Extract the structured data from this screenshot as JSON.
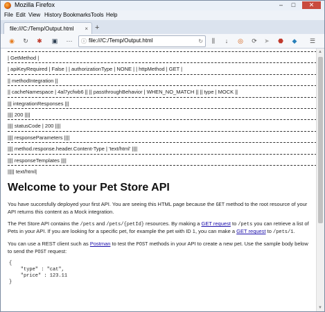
{
  "window": {
    "title": "Mozilla Firefox",
    "minimize": "–",
    "maximize": "□",
    "close": "✕"
  },
  "menu": [
    "File",
    "Edit",
    "View",
    "History",
    "Bookmarks",
    "Tools",
    "Help"
  ],
  "tab": {
    "title": "file:///C:/Temp/Output.html",
    "close": "×",
    "new_tab": "+"
  },
  "address": {
    "url": "file:///C:/Temp/Output.html"
  },
  "page": {
    "lines": [
      "| GetMethod |",
      "| apiKeyRequired | False | | authorizationType | NONE | | httpMethod | GET |",
      "|| methodIntegration ||",
      "|| cacheNamespace | 4al7ycfwb6 || || passthroughBehavior | WHEN_NO_MATCH || || type | MOCK ||",
      "||| integrationResponses |||",
      "|||| 200 ||||",
      "|||| statusCode | 200 ||||",
      "|||| responseParameters ||||",
      "|||| method.response.header.Content-Type | 'text/html' ||||",
      "|||| responseTemplates ||||",
      "||||| text/html|"
    ],
    "heading": "Welcome to your Pet Store API",
    "p1": {
      "a": "You have succesfully deployed your first API. You are seeing this HTML page because the ",
      "code": "GET",
      "b": " method to the root resource of your API returns this content as a Mock integration."
    },
    "p2": {
      "a": "The Pet Store API contains the ",
      "c1": "/pets",
      "b": " and ",
      "c2": "/pets/{petId}",
      "c": " resources. By making a ",
      "l1": "GET request",
      "d": " to ",
      "c3": "/pets",
      "e": " you can retrieve a list of Pets in your API. If you are looking for a specific pet, for example the pet with ID 1, you can make a ",
      "l2": "GET request",
      "f": " to ",
      "c4": "/pets/1",
      "g": "."
    },
    "p3": {
      "a": "You can use a REST client such as ",
      "link": "Postman",
      "b": " to test the ",
      "code": "POST",
      "c": " methods in your API to create a new pet. Use the sample body below to send the ",
      "code2": "POST",
      "d": " request:"
    },
    "code_block": "{\n    \"type\" : \"cat\",\n    \"price\" : 123.11\n}"
  }
}
